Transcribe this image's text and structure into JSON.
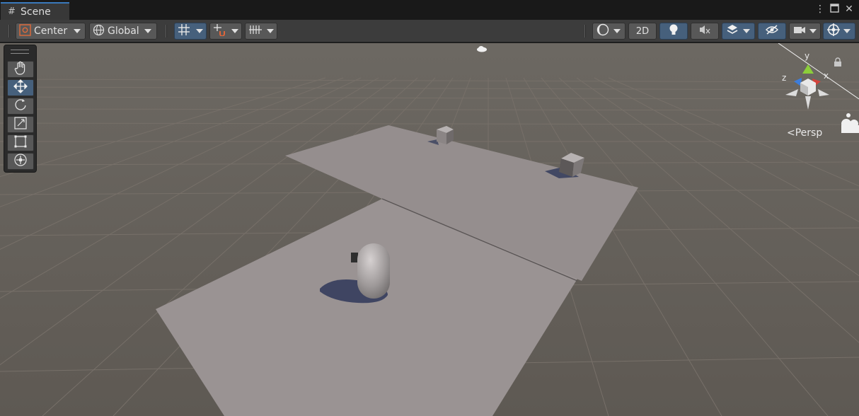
{
  "tab": {
    "label": "Scene",
    "icon": "grid-icon"
  },
  "window_controls": {
    "menu_icon": "kebab-menu-icon",
    "maximize_icon": "maximize-icon",
    "close_icon": "close-icon"
  },
  "toolbar": {
    "pivot": {
      "label": "Center",
      "icon": "pivot-center-icon"
    },
    "space": {
      "label": "Global",
      "icon": "globe-icon"
    },
    "grid_snap_icon": "grid-snap-icon",
    "incremental_snap_icon": "snap-magnet-icon",
    "grid_visibility_icon": "grid-visibility-icon",
    "shading_icon": "shading-mode-icon",
    "mode_2d_label": "2D",
    "lighting_icon": "lightbulb-icon",
    "audio_icon": "audio-mute-icon",
    "effects_icon": "layers-icon",
    "hidden_icon": "visibility-icon",
    "camera_icon": "camera-icon",
    "gizmos_icon": "gizmo-icon",
    "accent": "#46607c"
  },
  "tools": [
    {
      "name": "hand-tool",
      "icon": "hand-icon",
      "active": false
    },
    {
      "name": "move-tool",
      "icon": "move-icon",
      "active": true
    },
    {
      "name": "rotate-tool",
      "icon": "rotate-icon",
      "active": false
    },
    {
      "name": "scale-tool",
      "icon": "scale-icon",
      "active": false
    },
    {
      "name": "rect-tool",
      "icon": "rect-icon",
      "active": false
    },
    {
      "name": "transform-tool",
      "icon": "transform-icon",
      "active": false
    }
  ],
  "gizmo": {
    "x_label": "x",
    "y_label": "y",
    "z_label": "z",
    "projection_label": "Persp"
  },
  "colors": {
    "floor": "#5e5953",
    "plane": "#9a9393",
    "x_axis": "#d1433c",
    "y_axis": "#8cce3a",
    "z_axis": "#3d7ddb"
  }
}
